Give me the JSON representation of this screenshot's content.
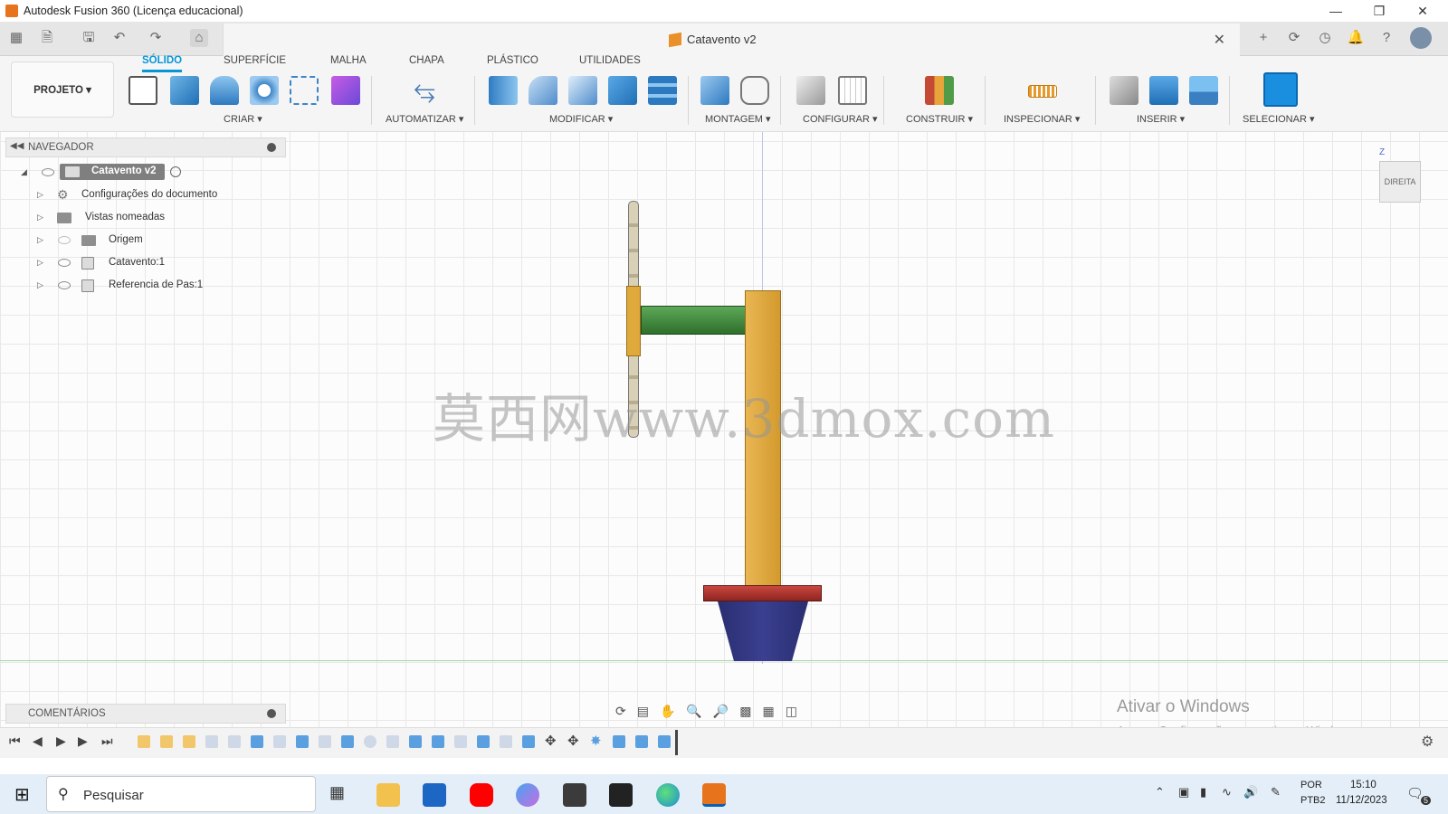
{
  "window": {
    "title": "Autodesk Fusion 360 (Licença educacional)",
    "controls": [
      "minimize-icon",
      "restore-icon",
      "close-icon"
    ]
  },
  "document": {
    "tab_title": "Catavento v2"
  },
  "ribbon": {
    "project_button": "PROJETO ▾",
    "tabs": [
      "SÓLIDO",
      "SUPERFÍCIE",
      "MALHA",
      "CHAPA",
      "PLÁSTICO",
      "UTILIDADES"
    ],
    "active_tab": "SÓLIDO",
    "groups": [
      "CRIAR ▾",
      "AUTOMATIZAR ▾",
      "MODIFICAR ▾",
      "MONTAGEM ▾",
      "CONFIGURAR ▾",
      "CONSTRUIR ▾",
      "INSPECIONAR ▾",
      "INSERIR ▾",
      "SELECIONAR ▾"
    ]
  },
  "navigator": {
    "title": "NAVEGADOR",
    "root": "Catavento v2",
    "items": [
      {
        "label": "Configurações do documento",
        "icon": "gear-icon"
      },
      {
        "label": "Vistas nomeadas",
        "icon": "folder-icon"
      },
      {
        "label": "Origem",
        "icon": "folder-icon"
      },
      {
        "label": "Catavento:1",
        "icon": "component-icon"
      },
      {
        "label": "Referencia de Pas:1",
        "icon": "component-icon"
      }
    ]
  },
  "viewcube": {
    "face": "DIREITA",
    "axis": "Z"
  },
  "watermark": "莫西网www.3dmox.com",
  "comments": {
    "title": "COMENTÁRIOS"
  },
  "activation": {
    "title": "Ativar o Windows",
    "subtitle": "Acesse Configurações para ativar o Windows."
  },
  "taskbar": {
    "search_placeholder": "Pesquisar",
    "lang_top": "POR",
    "lang_bottom": "PTB2",
    "time": "15:10",
    "date": "11/12/2023",
    "notifications": "5"
  },
  "colors": {
    "accent": "#0696d7",
    "tower": "#e0a93c",
    "shaft": "#3e8b3a",
    "base_ring": "#b0302b",
    "base_cone": "#2f3379"
  }
}
